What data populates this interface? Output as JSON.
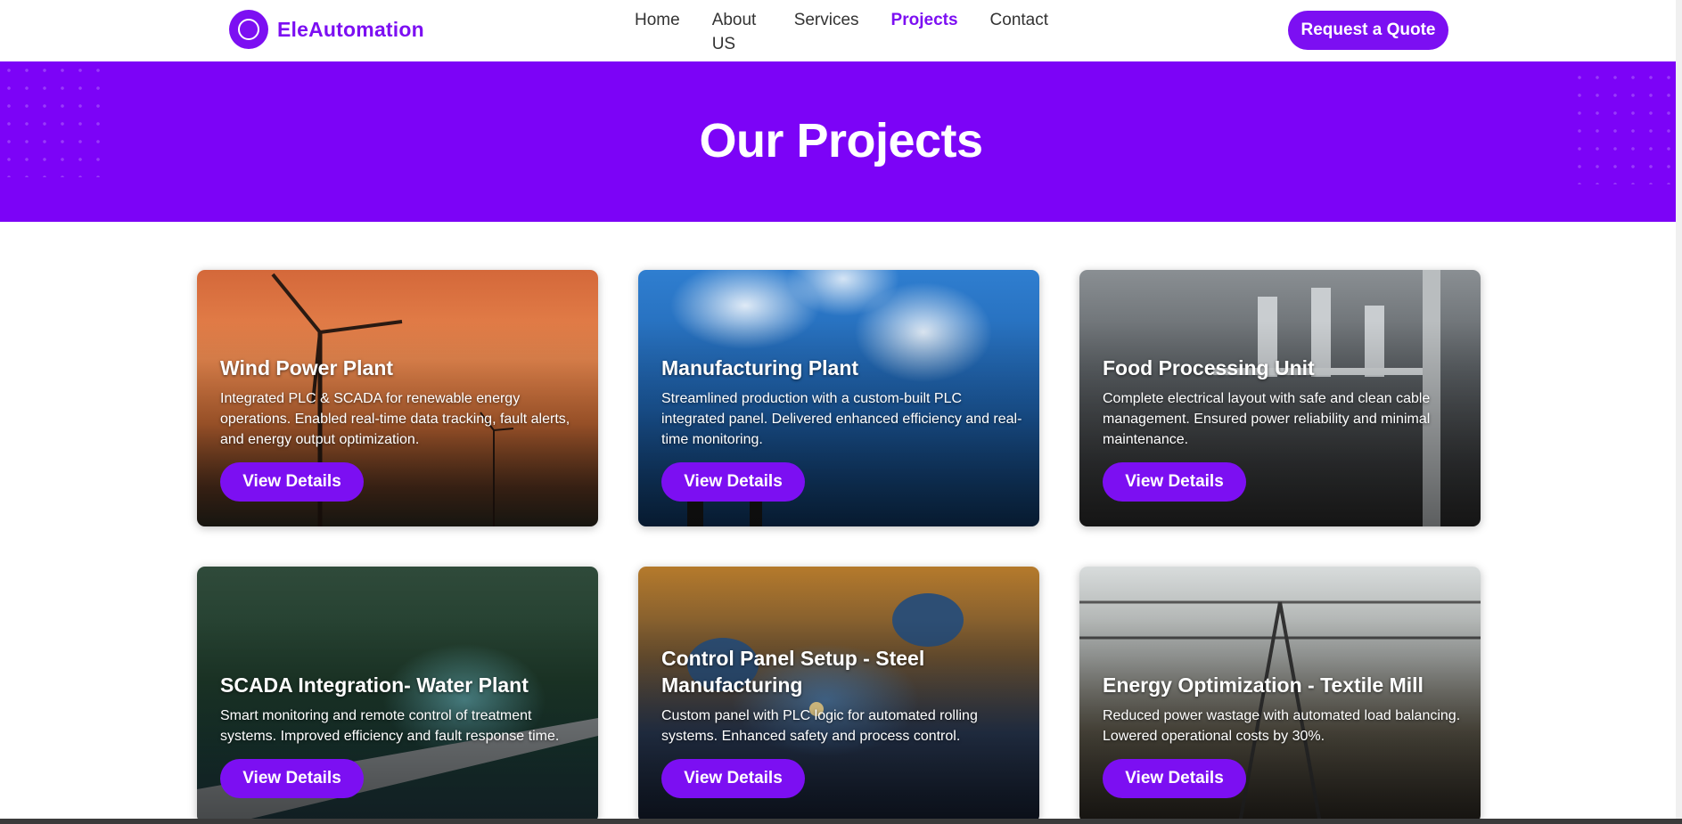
{
  "header": {
    "brand": "EleAutomation",
    "nav": [
      {
        "label": "Home",
        "active": false
      },
      {
        "label": "About US",
        "active": false
      },
      {
        "label": "Services",
        "active": false
      },
      {
        "label": "Projects",
        "active": true
      },
      {
        "label": "Contact",
        "active": false
      }
    ],
    "cta": "Request a Quote"
  },
  "hero": {
    "title": "Our Projects"
  },
  "projects": [
    {
      "title": "Wind Power Plant",
      "description": "Integrated PLC & SCADA for renewable energy operations. Enabled real-time data tracking, fault alerts, and energy output optimization.",
      "button": "View Details",
      "image": "wind-turbines-sunset"
    },
    {
      "title": "Manufacturing Plant",
      "description": "Streamlined production with a custom-built PLC integrated panel. Delivered enhanced efficiency and real-time monitoring.",
      "button": "View Details",
      "image": "factory-chimney-clouds"
    },
    {
      "title": "Food Processing Unit",
      "description": "Complete electrical layout with safe and clean cable management. Ensured power reliability and minimal maintenance.",
      "button": "View Details",
      "image": "food-processing-machinery"
    },
    {
      "title": "SCADA Integration- Water Plant",
      "description": "Smart monitoring and remote control of treatment systems. Improved efficiency and fault response time.",
      "button": "View Details",
      "image": "water-plant-aerial"
    },
    {
      "title": "Control Panel Setup - Steel Manufacturing",
      "description": "Custom panel with PLC logic for automated rolling systems. Enhanced safety and process control.",
      "button": "View Details",
      "image": "welders-steel"
    },
    {
      "title": "Energy Optimization - Textile Mill",
      "description": "Reduced power wastage with automated load balancing. Lowered operational costs by 30%.",
      "button": "View Details",
      "image": "textile-looms"
    }
  ],
  "colors": {
    "accent": "#7c0ff2",
    "hero_bg": "#7c03f7"
  }
}
